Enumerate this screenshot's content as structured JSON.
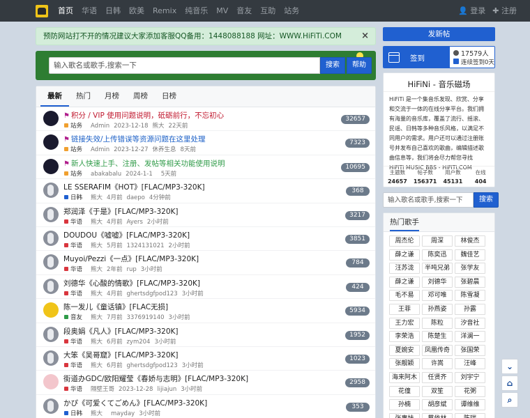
{
  "nav": {
    "items": [
      "首页",
      "华语",
      "日韩",
      "欧美",
      "Remix",
      "纯音乐",
      "MV",
      "音友",
      "互助",
      "站务"
    ],
    "active": 0,
    "login": "登录",
    "register": "注册"
  },
  "notice": {
    "text": "预防网站打不开的情况建议大家添加客服QQ备用：1448088188 网址：WWW.HiFiTi.COM",
    "close": "×"
  },
  "search": {
    "placeholder": "输入歌名或歌手,搜索一下",
    "button": "搜索",
    "help": "帮助"
  },
  "tabs": [
    "最新",
    "热门",
    "月榜",
    "周榜",
    "日榜"
  ],
  "threads": [
    {
      "title": "积分 / VIP 使用问题说明，砥砺前行，不忘初心",
      "style": "red",
      "flag": true,
      "forum": "站务",
      "forum_color": "#f0a030",
      "author": "Admin",
      "date": "2023-12-18",
      "last_user": "熊大",
      "last_time": "22天前",
      "count": "32657",
      "avatar": "dark"
    },
    {
      "title": "链接失效/上传错误等资源问题在这里处理",
      "style": "blue",
      "flag": true,
      "forum": "站务",
      "forum_color": "#f0a030",
      "author": "Admin",
      "date": "2023-12-27",
      "last_user": "休养生息",
      "last_time": "8天前",
      "count": "7323",
      "avatar": "dark"
    },
    {
      "title": "新人快速上手、注册、发帖等相关功能使用说明",
      "style": "green",
      "flag": true,
      "forum": "站务",
      "forum_color": "#f0a030",
      "author": "abakabalu",
      "date": "2024-1-1",
      "last_user": "",
      "last_time": "5天前",
      "count": "10695",
      "avatar": "dark"
    },
    {
      "title": "LE SSERAFIM《HOT》[FLAC/MP3-320K]",
      "style": "",
      "flag": false,
      "forum": "日韩",
      "forum_color": "#2060d0",
      "author": "熊大",
      "date": "4月前",
      "last_user": "daepo",
      "last_time": "4分钟前",
      "count": "368",
      "avatar": "gray"
    },
    {
      "title": "郑润泽《于是》[FLAC/MP3-320K]",
      "style": "",
      "flag": false,
      "forum": "华语",
      "forum_color": "#d9363e",
      "author": "熊大",
      "date": "4月前",
      "last_user": "Ayers",
      "last_time": "2小时前",
      "count": "3217",
      "avatar": "gray"
    },
    {
      "title": "DOUDOU《嘘嘘》[FLAC/MP3-320K]",
      "style": "",
      "flag": false,
      "forum": "华语",
      "forum_color": "#d9363e",
      "author": "熊大",
      "date": "5月前",
      "last_user": "1324131021",
      "last_time": "2小时前",
      "count": "3851",
      "avatar": "gray"
    },
    {
      "title": "Muyoi/Pezzi《一点》[FLAC/MP3-320K]",
      "style": "",
      "flag": false,
      "forum": "华语",
      "forum_color": "#d9363e",
      "author": "熊大",
      "date": "2年前",
      "last_user": "rup",
      "last_time": "3小时前",
      "count": "784",
      "avatar": "gray"
    },
    {
      "title": "刘德华《心酸的情歌》[FLAC/MP3-320K]",
      "style": "",
      "flag": false,
      "forum": "华语",
      "forum_color": "#d9363e",
      "author": "熊大",
      "date": "4月前",
      "last_user": "ghertsdgfpod123",
      "last_time": "3小时前",
      "count": "424",
      "avatar": "gray"
    },
    {
      "title": "陈一发儿《童话镇》[FLAC无损]",
      "style": "",
      "flag": false,
      "forum": "音友",
      "forum_color": "#2f9b48",
      "author": "熊大",
      "date": "7月前",
      "last_user": "3376919140",
      "last_time": "3小时前",
      "count": "5934",
      "avatar": "yellow"
    },
    {
      "title": "段奥娟《凡人》[FLAC/MP3-320K]",
      "style": "",
      "flag": false,
      "forum": "华语",
      "forum_color": "#d9363e",
      "author": "熊大",
      "date": "6月前",
      "last_user": "zym204",
      "last_time": "3小时前",
      "count": "1952",
      "avatar": "gray"
    },
    {
      "title": "大笨《吴哥窟》[FLAC/MP3-320K]",
      "style": "",
      "flag": false,
      "forum": "华语",
      "forum_color": "#d9363e",
      "author": "熊大",
      "date": "6月前",
      "last_user": "ghertsdgfpod123",
      "last_time": "3小时前",
      "count": "1023",
      "avatar": "gray"
    },
    {
      "title": "街道办GDC/欧阳耀莹《春娇与志明》[FLAC/MP3-320K]",
      "style": "",
      "flag": false,
      "forum": "华语",
      "forum_color": "#d9363e",
      "author": "隔壁王哥",
      "date": "2023-12-28",
      "last_user": "lijiajun",
      "last_time": "3小时前",
      "count": "2958",
      "avatar": "pink"
    },
    {
      "title": "かぴ《可爱くてごめん》[FLAC/MP3-320K]",
      "style": "",
      "flag": false,
      "forum": "日韩",
      "forum_color": "#2060d0",
      "author": "熊大",
      "date": "",
      "last_user": "mayday",
      "last_time": "3小时前",
      "count": "353",
      "avatar": "gray"
    }
  ],
  "side": {
    "post_button": "发新帖",
    "signin_label": "签到",
    "signin_people": "17579人",
    "signin_streak": "连续签到0天",
    "site_title": "HiFiNi - 音乐磁场",
    "site_desc": "HiFiTi 是一个集音乐发现、欣赏、分享和交流于一体的在线分享平台。我们拥有海量的音乐库，覆盖了流行、摇滚、民谣、日韩等多种音乐风格，以满足不同用户的需求。用户还可以通过注册账号并发布自己喜欢的歌曲，编辑描述歌曲信息等，我们将会尽力帮您寻找",
    "site_footer": "HiFiTi MUSIC BBS - HiFiTi.COM",
    "stats": [
      {
        "label": "主题数",
        "value": "24657"
      },
      {
        "label": "帖子数",
        "value": "156371"
      },
      {
        "label": "用户数",
        "value": "45131"
      },
      {
        "label": "在线",
        "value": "404"
      }
    ],
    "search_placeholder": "输入歌名或歌手,搜索一下",
    "search_button": "搜索",
    "hot_title": "热门歌手",
    "singers": [
      "周杰伦",
      "周深",
      "林俊杰",
      "薛之谦",
      "陈奕迅",
      "魏佳艺",
      "汪苏泷",
      "半吨兄弟",
      "张学友",
      "薛之谦",
      "刘德华",
      "张碧晨",
      "毛不易",
      "邓可唯",
      "陈雪凝",
      "王菲",
      "孙燕姿",
      "孙露",
      "王力宏",
      "陈粒",
      "汐音社",
      "李荣浩",
      "陈楚生",
      "洋澜一",
      "夏婉安",
      "凤凰传奇",
      "张国荣",
      "张靓颖",
      "许嵩",
      "汪峰",
      "海来阿木",
      "任贤齐",
      "刘宇宁",
      "花僮",
      "双笙",
      "花粥",
      "孙楠",
      "胡彦斌",
      "谭维维",
      "张惠妹",
      "蔡依林",
      "陈瑞"
    ]
  },
  "float": {
    "down": "⌄",
    "home": "⌂",
    "search": "⌕"
  }
}
